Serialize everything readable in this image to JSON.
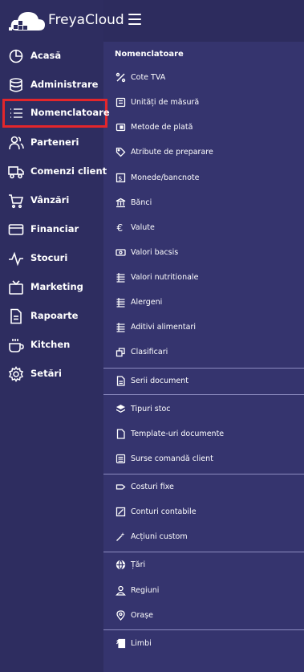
{
  "brand": {
    "name": "FreyaCloud"
  },
  "sidebar": {
    "items": [
      {
        "label": "Acasă",
        "icon": "pie-chart-icon"
      },
      {
        "label": "Administrare",
        "icon": "database-icon"
      },
      {
        "label": "Nomenclatoare",
        "icon": "list-icon",
        "active": true
      },
      {
        "label": "Parteneri",
        "icon": "users-icon"
      },
      {
        "label": "Comenzi client",
        "icon": "truck-icon"
      },
      {
        "label": "Vânzări",
        "icon": "cart-icon"
      },
      {
        "label": "Financiar",
        "icon": "credit-card-icon"
      },
      {
        "label": "Stocuri",
        "icon": "activity-icon"
      },
      {
        "label": "Marketing",
        "icon": "tv-icon"
      },
      {
        "label": "Rapoarte",
        "icon": "report-icon"
      },
      {
        "label": "Kitchen",
        "icon": "coffee-icon"
      },
      {
        "label": "Setări",
        "icon": "gear-icon"
      }
    ]
  },
  "submenu": {
    "title": "Nomenclatoare",
    "items": [
      {
        "label": "Cote TVA",
        "icon": "percent-icon"
      },
      {
        "label": "Unități de măsură",
        "icon": "ruler-icon"
      },
      {
        "label": "Metode de plată",
        "icon": "wallet-icon"
      },
      {
        "label": "Atribute de preparare",
        "icon": "tag-icon"
      },
      {
        "label": "Monede/bancnote",
        "icon": "currency-icon"
      },
      {
        "label": "Bănci",
        "icon": "bank-icon"
      },
      {
        "label": "Valute",
        "icon": "euro-icon"
      },
      {
        "label": "Valori bacsis",
        "icon": "cash-icon"
      },
      {
        "label": "Valori nutritionale",
        "icon": "nutrition-icon"
      },
      {
        "label": "Alergeni",
        "icon": "allergen-icon"
      },
      {
        "label": "Aditivi alimentari",
        "icon": "additive-icon"
      },
      {
        "label": "Clasificari",
        "icon": "classification-icon"
      },
      {
        "label": "Serii document",
        "icon": "document-icon"
      },
      {
        "label": "Tipuri stoc",
        "icon": "layers-icon"
      },
      {
        "label": "Template-uri documente",
        "icon": "file-icon"
      },
      {
        "label": "Surse comandă client",
        "icon": "source-icon"
      },
      {
        "label": "Costuri fixe",
        "icon": "price-tag-icon"
      },
      {
        "label": "Conturi contabile",
        "icon": "account-icon"
      },
      {
        "label": "Acțiuni custom",
        "icon": "wand-icon"
      },
      {
        "label": "Țări",
        "icon": "globe-icon"
      },
      {
        "label": "Regiuni",
        "icon": "region-icon"
      },
      {
        "label": "Orașe",
        "icon": "location-icon"
      },
      {
        "label": "Limbi",
        "icon": "language-icon"
      }
    ]
  }
}
